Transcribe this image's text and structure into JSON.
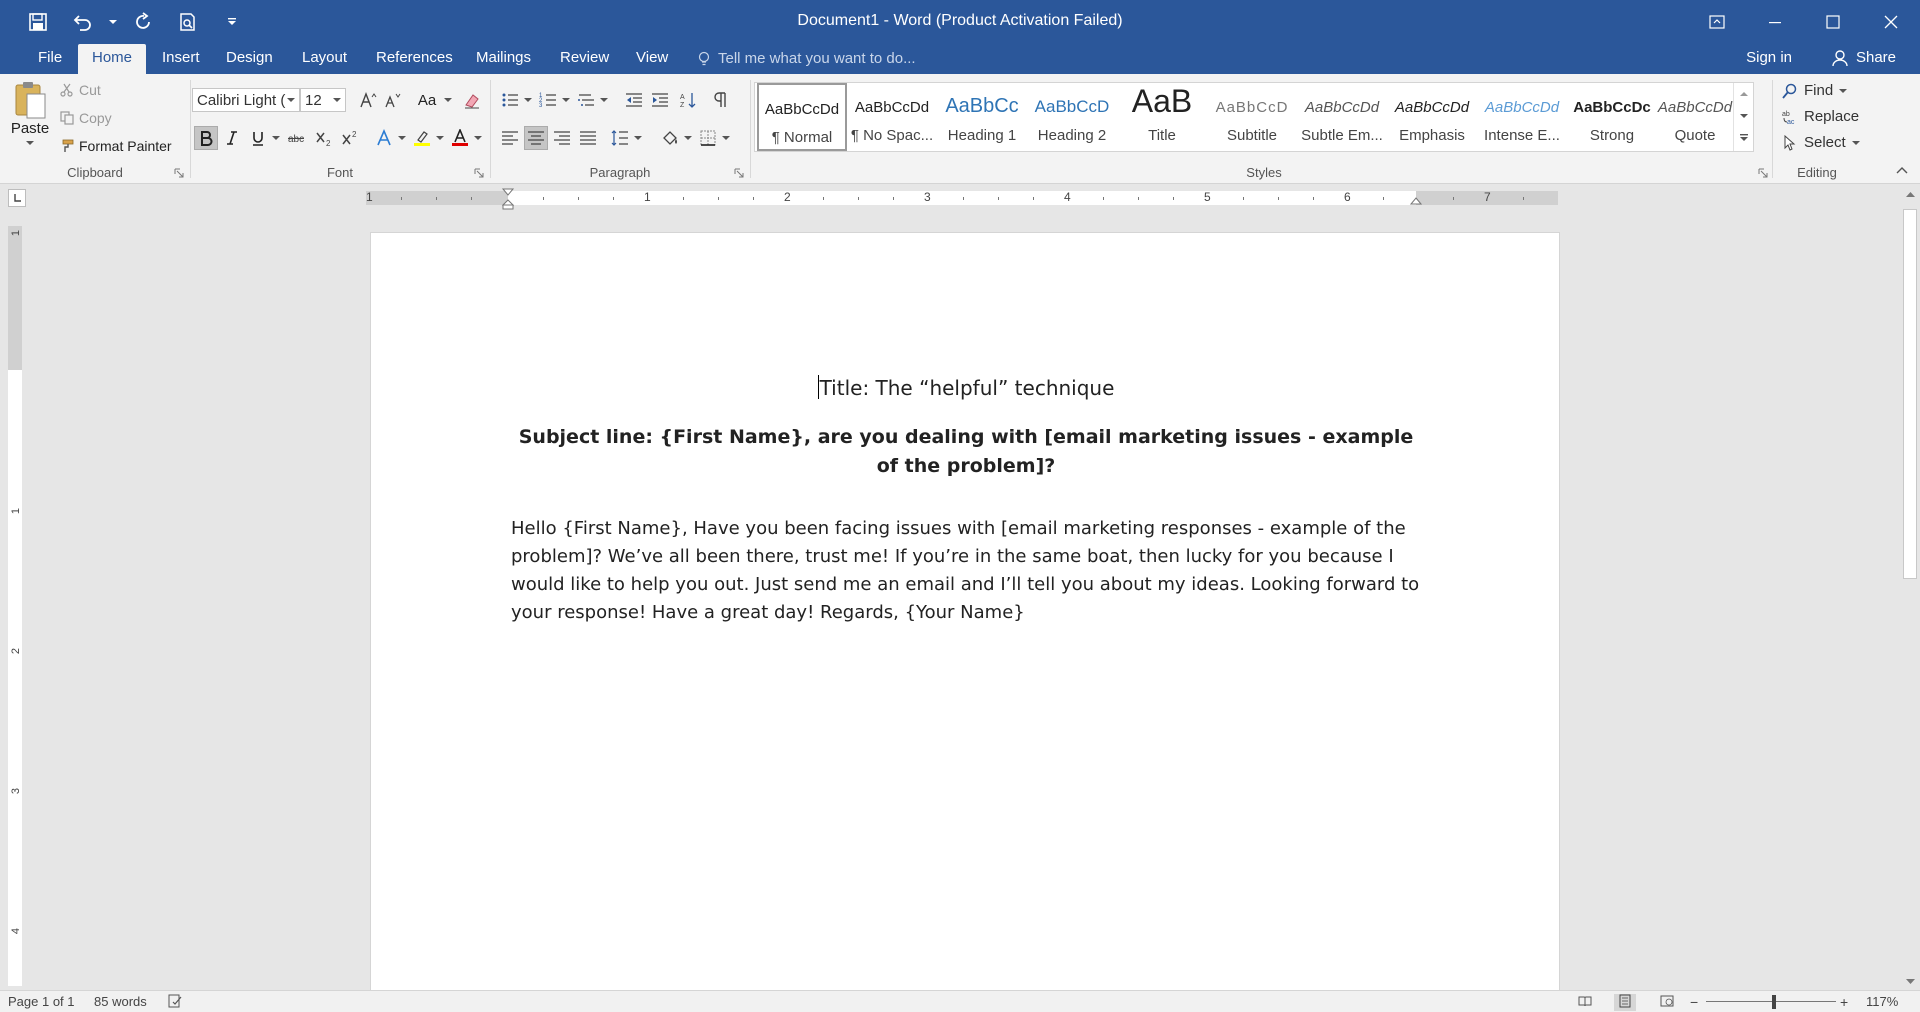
{
  "window": {
    "title": "Document1 - Word (Product Activation Failed)"
  },
  "tabs": [
    "File",
    "Home",
    "Insert",
    "Design",
    "Layout",
    "References",
    "Mailings",
    "Review",
    "View"
  ],
  "tellme": {
    "placeholder": "Tell me what you want to do..."
  },
  "account": {
    "signin": "Sign in",
    "share": "Share"
  },
  "clipboard": {
    "label": "Clipboard",
    "paste": "Paste",
    "cut": "Cut",
    "copy": "Copy",
    "format_painter": "Format Painter"
  },
  "font": {
    "label": "Font",
    "name": "Calibri Light (",
    "size": "12",
    "change_case": "Aa"
  },
  "paragraph": {
    "label": "Paragraph"
  },
  "styles": {
    "label": "Styles",
    "items": [
      {
        "sample": "AaBbCcDd",
        "name": "¶ Normal"
      },
      {
        "sample": "AaBbCcDd",
        "name": "¶ No Spac..."
      },
      {
        "sample": "AaBbCc",
        "name": "Heading 1"
      },
      {
        "sample": "AaBbCcD",
        "name": "Heading 2"
      },
      {
        "sample": "AaB",
        "name": "Title"
      },
      {
        "sample": "AaBbCcD",
        "name": "Subtitle"
      },
      {
        "sample": "AaBbCcDd",
        "name": "Subtle Em..."
      },
      {
        "sample": "AaBbCcDd",
        "name": "Emphasis"
      },
      {
        "sample": "AaBbCcDd",
        "name": "Intense E..."
      },
      {
        "sample": "AaBbCcDc",
        "name": "Strong"
      },
      {
        "sample": "AaBbCcDd",
        "name": "Quote"
      }
    ]
  },
  "editing": {
    "label": "Editing",
    "find": "Find",
    "replace": "Replace",
    "select": "Select"
  },
  "ruler": {
    "h_numbers": [
      "1",
      "1",
      "2",
      "3",
      "4",
      "5",
      "6",
      "7"
    ],
    "v_numbers": [
      "1",
      "1",
      "2",
      "3",
      "4"
    ]
  },
  "document": {
    "title": "Title: The “helpful” technique",
    "subject": "Subject line: {First Name}, are you dealing with [email marketing issues - example of the problem]?",
    "body": "Hello {First Name}, Have you been facing issues with [email marketing responses - example of the problem]? We’ve all been there, trust me! If you’re in the same boat, then lucky for you because I would like to help you out. Just send me an email and I’ll tell you about my ideas. Looking forward to your response! Have a great day! Regards, {Your Name}"
  },
  "status": {
    "page": "Page 1 of 1",
    "words": "85 words",
    "zoom": "117%"
  },
  "colors": {
    "brand": "#2b579a",
    "highlight": "#ffff00",
    "font_color": "#e00000"
  }
}
